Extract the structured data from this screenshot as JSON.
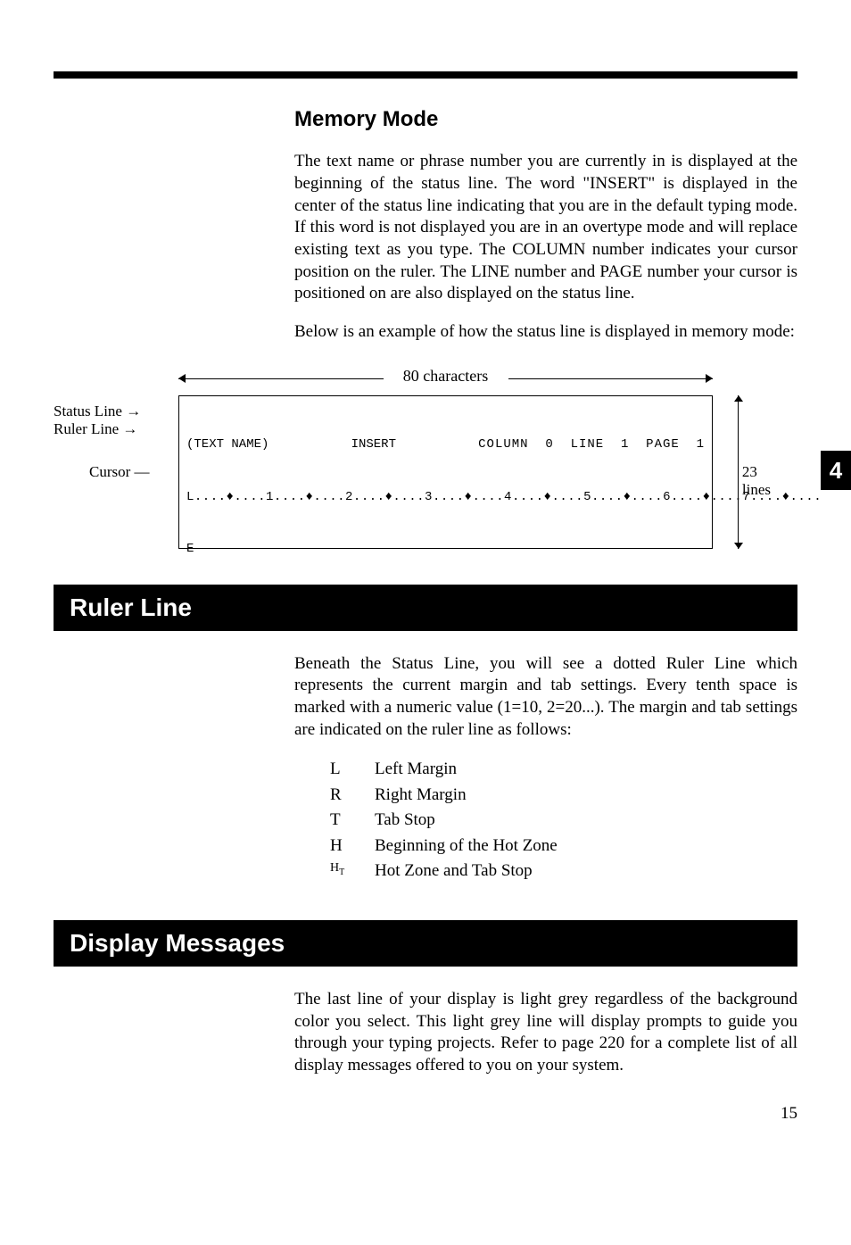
{
  "page": {
    "number": "15",
    "tab": "4"
  },
  "memory_mode": {
    "title": "Memory Mode",
    "para1": "The text name or phrase number you are currently in is displayed at the beginning of the status line. The word \"INSERT\" is displayed in the center of the status line indicating that you are in the default typing mode. If this word is not displayed you are in an overtype mode and will replace existing text as you type. The COLUMN number indicates your cursor position on the ruler. The LINE number and PAGE number your cursor is positioned on are also displayed on the status line.",
    "para2": "Below is an example of how the status line is displayed in memory mode:"
  },
  "diagram": {
    "width_label": "80 characters",
    "labels": {
      "status": "Status Line",
      "ruler": "Ruler Line",
      "cursor": "Cursor"
    },
    "status_line": {
      "text_name": "(TEXT NAME)",
      "mode": "INSERT",
      "right": "COLUMN  0  LINE  1  PAGE  1"
    },
    "ruler_line": "L....♦....1....♦....2....♦....3....♦....4....♦....5....♦....6....♦....7....♦....",
    "cursor_char": "E",
    "height_label_1": "23",
    "height_label_2": "lines"
  },
  "ruler_line": {
    "title": "Ruler Line",
    "para": "Beneath the Status Line, you will see a dotted Ruler Line which represents the current margin and tab settings. Every tenth space is marked with a numeric value (1=10, 2=20...). The margin and tab settings are indicated on the ruler line as follows:",
    "indicators": [
      {
        "sym": "L",
        "desc": "Left Margin"
      },
      {
        "sym": "R",
        "desc": "Right Margin"
      },
      {
        "sym": "T",
        "desc": "Tab Stop"
      },
      {
        "sym": "H",
        "desc": "Beginning of the Hot Zone"
      },
      {
        "sym": "HT",
        "desc": "Hot Zone and Tab Stop"
      }
    ]
  },
  "display_messages": {
    "title": "Display Messages",
    "para": "The last line of your display is light grey regardless of the background color you select. This light grey line will display prompts to guide you through your typing projects. Refer to page 220 for a complete list of all display messages offered to you on your system."
  }
}
